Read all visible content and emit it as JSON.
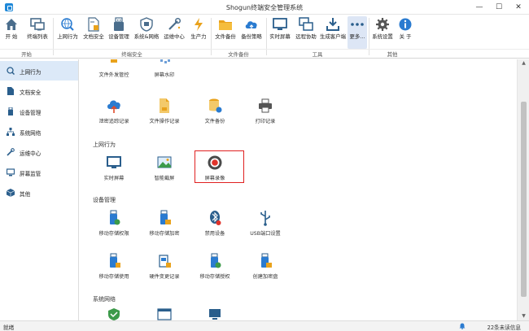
{
  "window": {
    "title": "Shogun终端安全管理系统",
    "minimize": "—",
    "maximize": "☐",
    "close": "✕"
  },
  "ribbon": {
    "buttons": [
      {
        "label": "开 始",
        "icon": "home-icon"
      },
      {
        "label": "终端列表",
        "icon": "terminal-list-icon"
      },
      {
        "label": "上网行为",
        "icon": "web-behavior-icon"
      },
      {
        "label": "文档安全",
        "icon": "document-security-icon"
      },
      {
        "label": "设备管理",
        "icon": "device-management-icon"
      },
      {
        "label": "系统&网络",
        "icon": "system-network-icon"
      },
      {
        "label": "运维中心",
        "icon": "ops-center-icon"
      },
      {
        "label": "生产力",
        "icon": "productivity-icon"
      },
      {
        "label": "文件备份",
        "icon": "file-backup-icon"
      },
      {
        "label": "备份策略",
        "icon": "backup-policy-icon"
      },
      {
        "label": "实时屏幕",
        "icon": "live-screen-icon"
      },
      {
        "label": "远程协助",
        "icon": "remote-assist-icon"
      },
      {
        "label": "生成客户端",
        "icon": "generate-client-icon"
      },
      {
        "label": "更多...",
        "icon": "more-icon"
      },
      {
        "label": "系统设置",
        "icon": "settings-icon"
      },
      {
        "label": "关 于",
        "icon": "about-icon"
      }
    ],
    "groups": [
      "开始",
      "终端安全",
      "文件备份",
      "工具",
      "其他"
    ]
  },
  "sidebar": {
    "items": [
      {
        "label": "上网行为",
        "icon": "search-globe-icon"
      },
      {
        "label": "文档安全",
        "icon": "document-icon"
      },
      {
        "label": "设备管理",
        "icon": "usb-device-icon"
      },
      {
        "label": "系统网络",
        "icon": "network-icon"
      },
      {
        "label": "运维中心",
        "icon": "wrench-icon"
      },
      {
        "label": "屏幕监管",
        "icon": "monitor-icon"
      },
      {
        "label": "其他",
        "icon": "cube-icon"
      }
    ]
  },
  "main": {
    "top_partial": [
      {
        "label": "文件外发管控",
        "icon": "file-outbound-icon"
      },
      {
        "label": "屏幕水印",
        "icon": "watermark-icon"
      }
    ],
    "doc_row": [
      {
        "label": "泄密追踪记录",
        "icon": "cloud-trace-icon"
      },
      {
        "label": "文件操作记录",
        "icon": "file-operation-icon"
      },
      {
        "label": "文件备份",
        "icon": "database-backup-icon"
      },
      {
        "label": "打印记录",
        "icon": "printer-icon"
      }
    ],
    "section_web": "上网行为",
    "web_row": [
      {
        "label": "实时屏幕",
        "icon": "live-monitor-icon"
      },
      {
        "label": "智能截屏",
        "icon": "smart-screenshot-icon"
      },
      {
        "label": "屏幕录像",
        "icon": "screen-record-icon"
      }
    ],
    "section_device": "设备管理",
    "device_row1": [
      {
        "label": "移动存储权限",
        "icon": "usb-permission-icon"
      },
      {
        "label": "移动存储加密",
        "icon": "usb-encrypt-icon"
      },
      {
        "label": "禁用设备",
        "icon": "bluetooth-disable-icon"
      },
      {
        "label": "USB端口设置",
        "icon": "usb-port-icon"
      }
    ],
    "device_row2": [
      {
        "label": "移动存储使用",
        "icon": "usb-usage-icon"
      },
      {
        "label": "硬件变更记录",
        "icon": "hardware-change-icon"
      },
      {
        "label": "移动存储授权",
        "icon": "usb-authorize-icon"
      },
      {
        "label": "创建加密盘",
        "icon": "encrypted-disk-icon"
      }
    ],
    "section_network": "系统网络"
  },
  "status": {
    "left": "就绪",
    "right": "22条未读信息"
  },
  "colors": {
    "accent": "#1e88d8",
    "highlight": "#e02020",
    "sidebar_active": "#dce9f8"
  }
}
